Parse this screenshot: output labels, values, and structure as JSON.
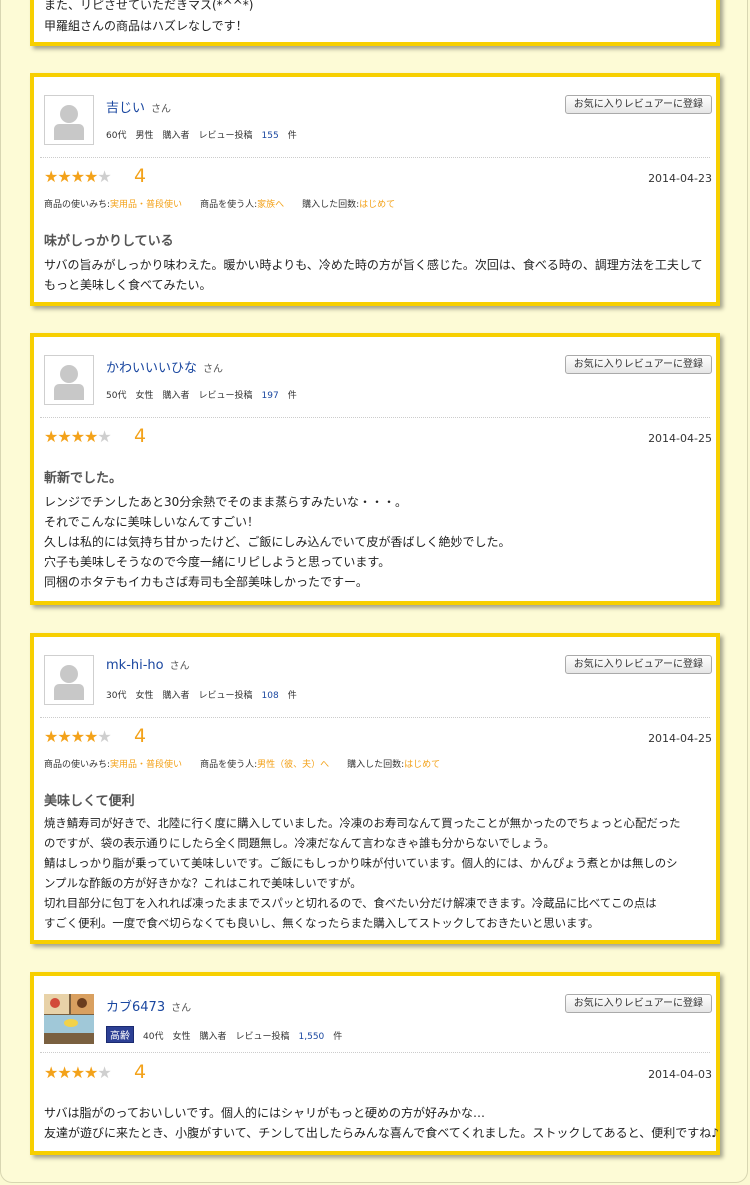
{
  "top_fragment": {
    "lines": [
      "また、リピさせていただきマス(*^^*)",
      "甲羅組さんの商品はハズレなしです！"
    ]
  },
  "fav_button_label": "お気に入りレビュアーに登録",
  "san": "さん",
  "labels": {
    "usage": "商品の使いみち:",
    "user": "商品を使う人:",
    "times": "購入した回数:",
    "buyer": "購入者",
    "review_posts": "レビュー投稿",
    "unit": "件"
  },
  "reviews": [
    {
      "name": "吉じい",
      "age": "60代",
      "gender": "男性",
      "count": "155",
      "rating": 4,
      "rating_text": "4",
      "date": "2014-04-23",
      "usage": "実用品・普段使い",
      "user": "家族へ",
      "times": "はじめて",
      "title": "味がしっかりしている",
      "body": [
        "サバの旨みがしっかり味わえた。暖かい時よりも、冷めた時の方が旨く感じた。次回は、食べる時の、調理方法を工夫して",
        "もっと美味しく食べてみたい。"
      ]
    },
    {
      "name": "かわいいいひな",
      "age": "50代",
      "gender": "女性",
      "count": "197",
      "rating": 4,
      "rating_text": "4",
      "date": "2014-04-25",
      "title": "斬新でした。",
      "body": [
        "レンジでチンしたあと30分余熱でそのまま蒸らすみたいな・・・。",
        "それでこんなに美味しいなんてすごい！",
        "久しは私的には気持ち甘かったけど、ご飯にしみ込んでいて皮が香ばしく絶妙でした。",
        "穴子も美味しそうなので今度一緒にリピしようと思っています。",
        "同梱のホタテもイカもさば寿司も全部美味しかったですー。"
      ]
    },
    {
      "name": "mk-hi-ho",
      "age": "30代",
      "gender": "女性",
      "count": "108",
      "rating": 4,
      "rating_text": "4",
      "date": "2014-04-25",
      "usage": "実用品・普段使い",
      "user": "男性（彼、夫）へ",
      "times": "はじめて",
      "title": "美味しくて便利",
      "body": [
        "焼き鯖寿司が好きで、北陸に行く度に購入していました。冷凍のお寿司なんて買ったことが無かったのでちょっと心配だった",
        "のですが、袋の表示通りにしたら全く問題無し。冷凍だなんて言わなきゃ誰も分からないでしょう。",
        "鯖はしっかり脂が乗っていて美味しいです。ご飯にもしっかり味が付いています。個人的には、かんぴょう煮とかは無しのシ",
        "ンプルな酢飯の方が好きかな？これはこれで美味しいですが。",
        "切れ目部分に包丁を入れれば凍ったままでスパッと切れるので、食べたい分だけ解凍できます。冷蔵品に比べてこの点は",
        "すごく便利。一度で食べ切らなくても良いし、無くなったらまた購入してストックしておきたいと思います。"
      ]
    },
    {
      "name": "カブ6473",
      "badge": "高齢",
      "age": "40代",
      "gender": "女性",
      "count": "1,550",
      "rating": 4,
      "rating_text": "4",
      "date": "2014-04-03",
      "body": [
        "サバは脂がのっておいしいです。個人的にはシャリがもっと硬めの方が好みかな…",
        "友達が遊びに来たとき、小腹がすいて、チンして出したらみんな喜んで食べてくれました。ストックしてあると、便利ですね♪"
      ]
    }
  ]
}
